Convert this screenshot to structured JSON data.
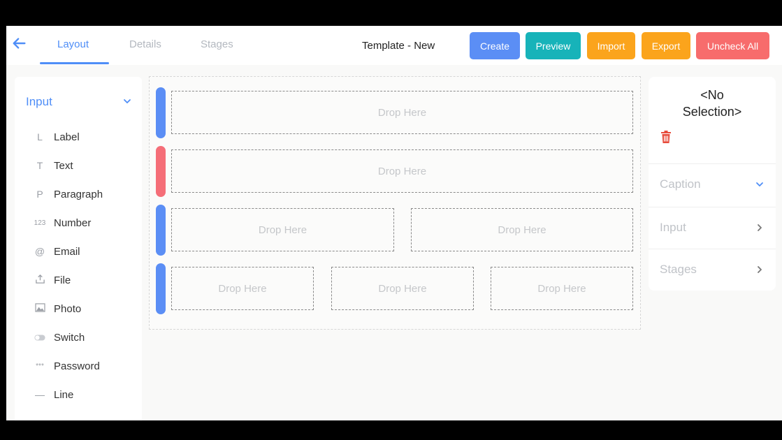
{
  "header": {
    "tabs": [
      {
        "label": "Layout"
      },
      {
        "label": "Details"
      },
      {
        "label": "Stages"
      }
    ],
    "title": "Template - New",
    "buttons": {
      "create": {
        "label": "Create",
        "color": "#5b8ef5"
      },
      "preview": {
        "label": "Preview",
        "color": "#17b3b9"
      },
      "import": {
        "label": "Import",
        "color": "#fba41c"
      },
      "export": {
        "label": "Export",
        "color": "#fba41c"
      },
      "uncheck_all": {
        "label": "Uncheck All",
        "color": "#f76c6c"
      }
    }
  },
  "palette": {
    "group_label": "Input",
    "items": [
      {
        "label": "Label",
        "icon": "label-icon",
        "glyph": "L"
      },
      {
        "label": "Text",
        "icon": "text-icon",
        "glyph": "T"
      },
      {
        "label": "Paragraph",
        "icon": "paragraph-icon",
        "glyph": "P"
      },
      {
        "label": "Number",
        "icon": "number-icon",
        "glyph": "123"
      },
      {
        "label": "Email",
        "icon": "email-icon",
        "glyph": "@"
      },
      {
        "label": "File",
        "icon": "upload-icon",
        "glyph": "⇧"
      },
      {
        "label": "Photo",
        "icon": "photo-icon",
        "glyph": "▨"
      },
      {
        "label": "Switch",
        "icon": "switch-icon",
        "glyph": "◐"
      },
      {
        "label": "Password",
        "icon": "password-icon",
        "glyph": "***"
      },
      {
        "label": "Line",
        "icon": "line-icon",
        "glyph": "—"
      }
    ]
  },
  "canvas": {
    "drop_label": "Drop Here",
    "rows": [
      {
        "handle_color": "#5b8ef5",
        "cells": [
          "Drop Here"
        ]
      },
      {
        "handle_color": "#f56e78",
        "cells": [
          "Drop Here"
        ]
      },
      {
        "handle_color": "#5b8ef5",
        "cells": [
          "Drop Here",
          "Drop Here"
        ]
      },
      {
        "handle_color": "#5b8ef5",
        "cells": [
          "Drop Here",
          "Drop Here",
          "Drop Here"
        ]
      }
    ]
  },
  "properties": {
    "no_selection_line1": "<No",
    "no_selection_line2": "Selection>",
    "sections": [
      {
        "label": "Caption",
        "icon": "chevron-down-icon"
      },
      {
        "label": "Input",
        "icon": "chevron-right-icon"
      },
      {
        "label": "Stages",
        "icon": "chevron-right-icon"
      }
    ]
  },
  "colors": {
    "accent": "#4f8ef7",
    "danger": "#e74c3c"
  }
}
